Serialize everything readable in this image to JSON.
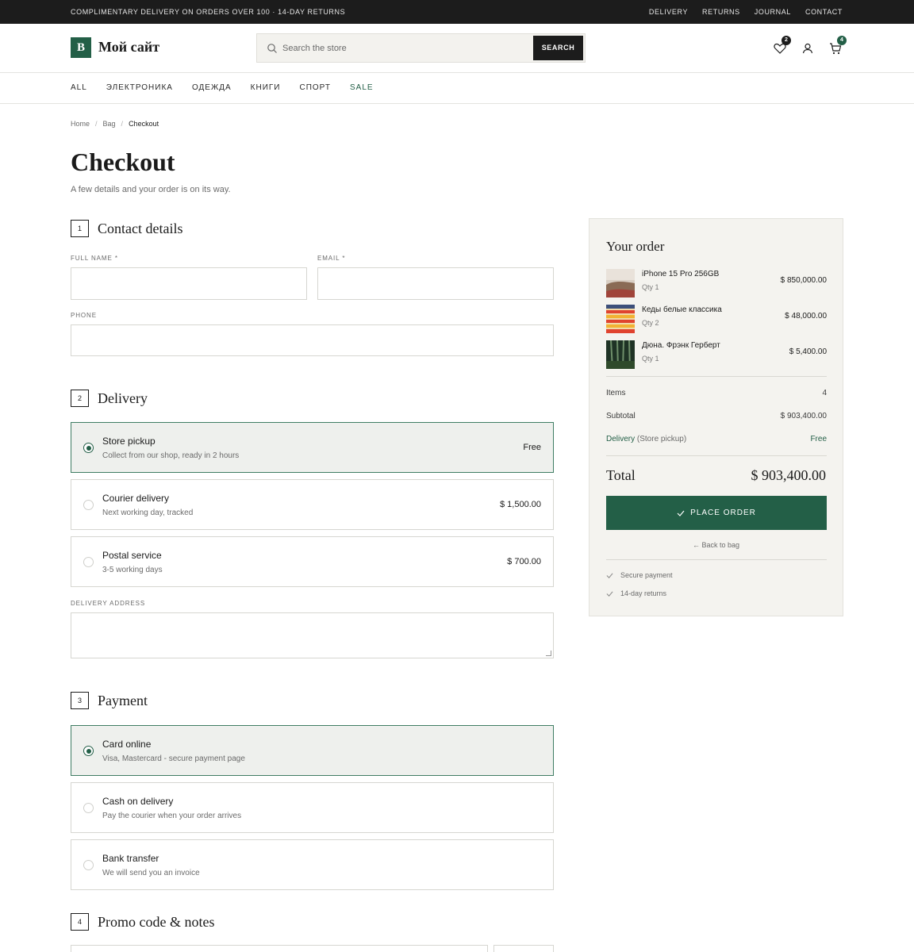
{
  "topbar": {
    "promo": "COMPLIMENTARY DELIVERY ON ORDERS OVER 100 · 14-DAY RETURNS",
    "links": [
      "DELIVERY",
      "RETURNS",
      "JOURNAL",
      "CONTACT"
    ]
  },
  "header": {
    "logo_letter": "B",
    "site_name": "Мой сайт",
    "search_placeholder": "Search the store",
    "search_button": "SEARCH",
    "wishlist_count": "2",
    "cart_count": "4"
  },
  "nav": {
    "items": [
      "ALL",
      "ЭЛЕКТРОНИКА",
      "ОДЕЖДА",
      "КНИГИ",
      "СПОРТ",
      "SALE"
    ]
  },
  "breadcrumb": [
    "Home",
    "Bag",
    "Checkout"
  ],
  "page": {
    "title": "Checkout",
    "subtitle": "A few details and your order is on its way."
  },
  "contact": {
    "num": "1",
    "title": "Contact details",
    "full_name_label": "FULL NAME *",
    "email_label": "EMAIL *",
    "phone_label": "PHONE"
  },
  "delivery": {
    "num": "2",
    "title": "Delivery",
    "options": [
      {
        "title": "Store pickup",
        "desc": "Collect from our shop, ready in 2 hours",
        "price": "Free"
      },
      {
        "title": "Courier delivery",
        "desc": "Next working day, tracked",
        "price": "$ 1,500.00"
      },
      {
        "title": "Postal service",
        "desc": "3-5 working days",
        "price": "$ 700.00"
      }
    ],
    "address_label": "DELIVERY ADDRESS"
  },
  "payment": {
    "num": "3",
    "title": "Payment",
    "options": [
      {
        "title": "Card online",
        "desc": "Visa, Mastercard - secure payment page"
      },
      {
        "title": "Cash on delivery",
        "desc": "Pay the courier when your order arrives"
      },
      {
        "title": "Bank transfer",
        "desc": "We will send you an invoice"
      }
    ]
  },
  "promo": {
    "num": "4",
    "title": "Promo code & notes"
  },
  "order": {
    "title": "Your order",
    "items": [
      {
        "name": "iPhone 15 Pro 256GB",
        "qty": "Qty 1",
        "price": "$ 850,000.00"
      },
      {
        "name": "Кеды белые классика",
        "qty": "Qty 2",
        "price": "$ 48,000.00"
      },
      {
        "name": "Дюна. Фрэнк Герберт",
        "qty": "Qty 1",
        "price": "$ 5,400.00"
      }
    ],
    "items_label": "Items",
    "items_value": "4",
    "subtotal_label": "Subtotal",
    "subtotal_value": "$ 903,400.00",
    "delivery_label": "Delivery",
    "delivery_method": "(Store pickup)",
    "delivery_value": "Free",
    "total_label": "Total",
    "total_value": "$ 903,400.00",
    "place_order": "PLACE ORDER",
    "back_to_bag": "Back to bag",
    "trust": [
      "Secure payment",
      "14-day returns"
    ]
  },
  "colors": {
    "accent": "#235f47",
    "topbar": "#1c1c1c",
    "summary_bg": "#f4f3ef"
  }
}
